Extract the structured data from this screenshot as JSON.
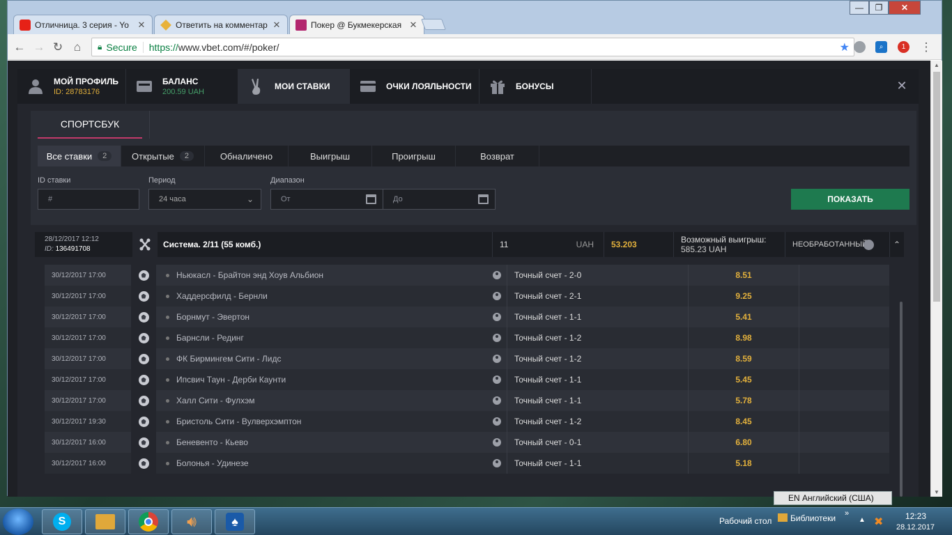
{
  "browser": {
    "tabs": [
      {
        "title": "Отличница. 3 серия - Yo",
        "favicon_color": "#e62117"
      },
      {
        "title": "Ответить на комментар",
        "favicon_color": "#e8b23a"
      },
      {
        "title": "Покер @ Букмекерская",
        "favicon_color": "#b3266e"
      }
    ],
    "secure_label": "Secure",
    "url_proto": "https://",
    "url_rest": "www.vbet.com/#/poker/",
    "window_controls": {
      "minimize": "—",
      "maximize": "❐",
      "close": "✕"
    }
  },
  "modal": {
    "tabs": [
      {
        "label": "МОЙ ПРОФИЛЬ",
        "sub": "ID: 28783176"
      },
      {
        "label": "БАЛАНС",
        "sub": "200.59 UAH"
      },
      {
        "label": "МОИ СТАВКИ",
        "sub": ""
      },
      {
        "label": "ОЧКИ ЛОЯЛЬНОСТИ",
        "sub": ""
      },
      {
        "label": "БОНУСЫ",
        "sub": ""
      }
    ],
    "section_tab": "СПОРТСБУК",
    "filters": [
      {
        "label": "Все ставки",
        "count": "2"
      },
      {
        "label": "Открытые",
        "count": "2"
      },
      {
        "label": "Обналичено",
        "count": ""
      },
      {
        "label": "Выигрыш",
        "count": ""
      },
      {
        "label": "Проигрыш",
        "count": ""
      },
      {
        "label": "Возврат",
        "count": ""
      }
    ],
    "form": {
      "id_label": "ID ставки",
      "id_placeholder": "#",
      "period_label": "Период",
      "period_value": "24 часа",
      "range_label": "Диапазон",
      "from_placeholder": "От",
      "to_placeholder": "До",
      "show_button": "ПОКАЗАТЬ"
    },
    "bet": {
      "datetime": "28/12/2017 12:12",
      "id_prefix": "ID:",
      "id": "136491708",
      "type": "Система. 2/11 (55 комб.)",
      "stake": "11",
      "currency": "UAH",
      "odds": "53.203",
      "possible_label": "Возможный выигрыш:",
      "possible_value": "585.23 UAH",
      "status": "НЕОБРАБОТАННЫЙ"
    },
    "events": [
      {
        "date": "30/12/2017 17:00",
        "match": "Ньюкасл - Брайтон энд Хоув Альбион",
        "market": "Точный счет - 2-0",
        "odds": "8.51"
      },
      {
        "date": "30/12/2017 17:00",
        "match": "Хаддерсфилд - Бернли",
        "market": "Точный счет - 2-1",
        "odds": "9.25"
      },
      {
        "date": "30/12/2017 17:00",
        "match": "Борнмут - Эвертон",
        "market": "Точный счет - 1-1",
        "odds": "5.41"
      },
      {
        "date": "30/12/2017 17:00",
        "match": "Барнсли - Рединг",
        "market": "Точный счет - 1-2",
        "odds": "8.98"
      },
      {
        "date": "30/12/2017 17:00",
        "match": "ФК Бирмингем Сити - Лидс",
        "market": "Точный счет - 1-2",
        "odds": "8.59"
      },
      {
        "date": "30/12/2017 17:00",
        "match": "Ипсвич Таун - Дерби Каунти",
        "market": "Точный счет - 1-1",
        "odds": "5.45"
      },
      {
        "date": "30/12/2017 17:00",
        "match": "Халл Сити - Фулхэм",
        "market": "Точный счет - 1-1",
        "odds": "5.78"
      },
      {
        "date": "30/12/2017 19:30",
        "match": "Бристоль Сити - Вулверхэмптон",
        "market": "Точный счет - 1-2",
        "odds": "8.45"
      },
      {
        "date": "30/12/2017 16:00",
        "match": "Беневенто - Кьево",
        "market": "Точный счет - 0-1",
        "odds": "6.80"
      },
      {
        "date": "30/12/2017 16:00",
        "match": "Болонья - Удинезе",
        "market": "Точный счет - 1-1",
        "odds": "5.18"
      }
    ]
  },
  "taskbar": {
    "language": "EN Английский (США)",
    "desktop": "Рабочий стол",
    "libraries": "Библиотеки",
    "time": "12:23",
    "date": "28.12.2017"
  },
  "colors": {
    "accent_gold": "#e2b03c",
    "accent_green": "#1e7a4f",
    "accent_pink": "#c23a6a"
  }
}
